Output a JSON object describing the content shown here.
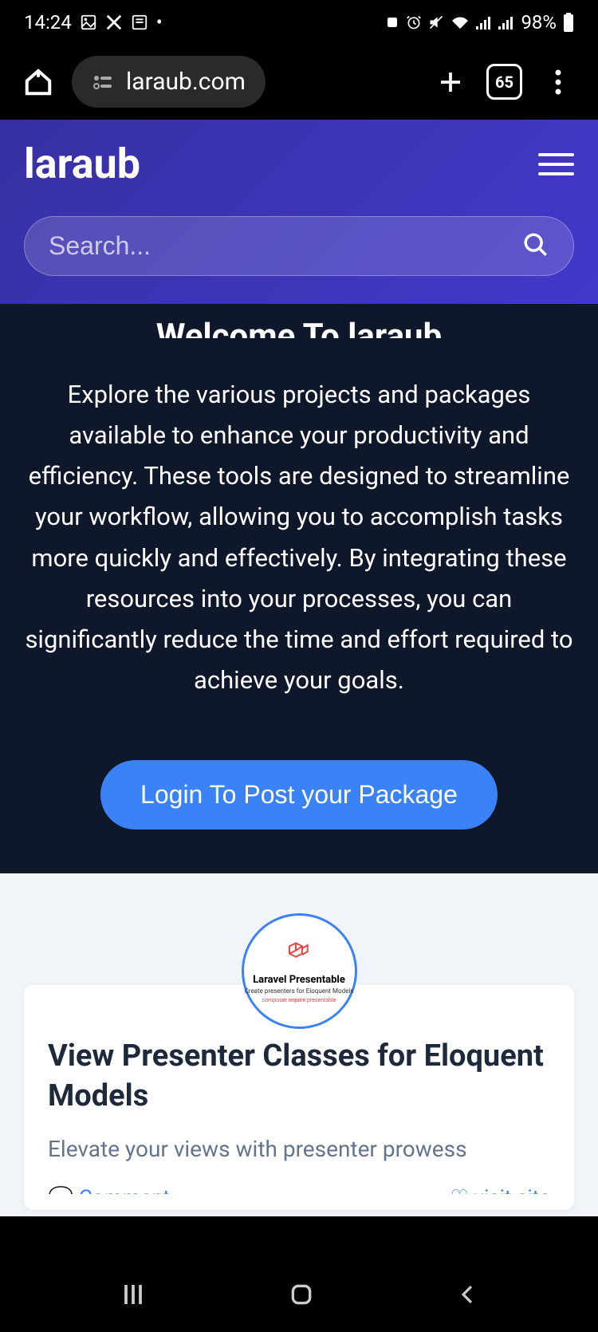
{
  "status_bar": {
    "time": "14:24",
    "battery": "98%"
  },
  "browser": {
    "url": "laraub.com",
    "tab_count": "65"
  },
  "header": {
    "logo": "laraub",
    "search_placeholder": "Search..."
  },
  "hero": {
    "title": "Welcome To laraub",
    "description": "Explore the various projects and packages available to enhance your productivity and efficiency. These tools are designed to streamline your workflow, allowing you to accomplish tasks more quickly and effectively. By integrating these resources into your processes, you can significantly reduce the time and effort required to achieve your goals.",
    "cta_label": "Login To Post your Package"
  },
  "card": {
    "badge_title": "Laravel Presentable",
    "badge_subtitle": "Create presenters for Eloquent Models",
    "title": "View Presenter Classes for Eloquent Models",
    "description": "Elevate your views with presenter prowess",
    "comment_label": "Comment",
    "visit_label": "visit site"
  }
}
